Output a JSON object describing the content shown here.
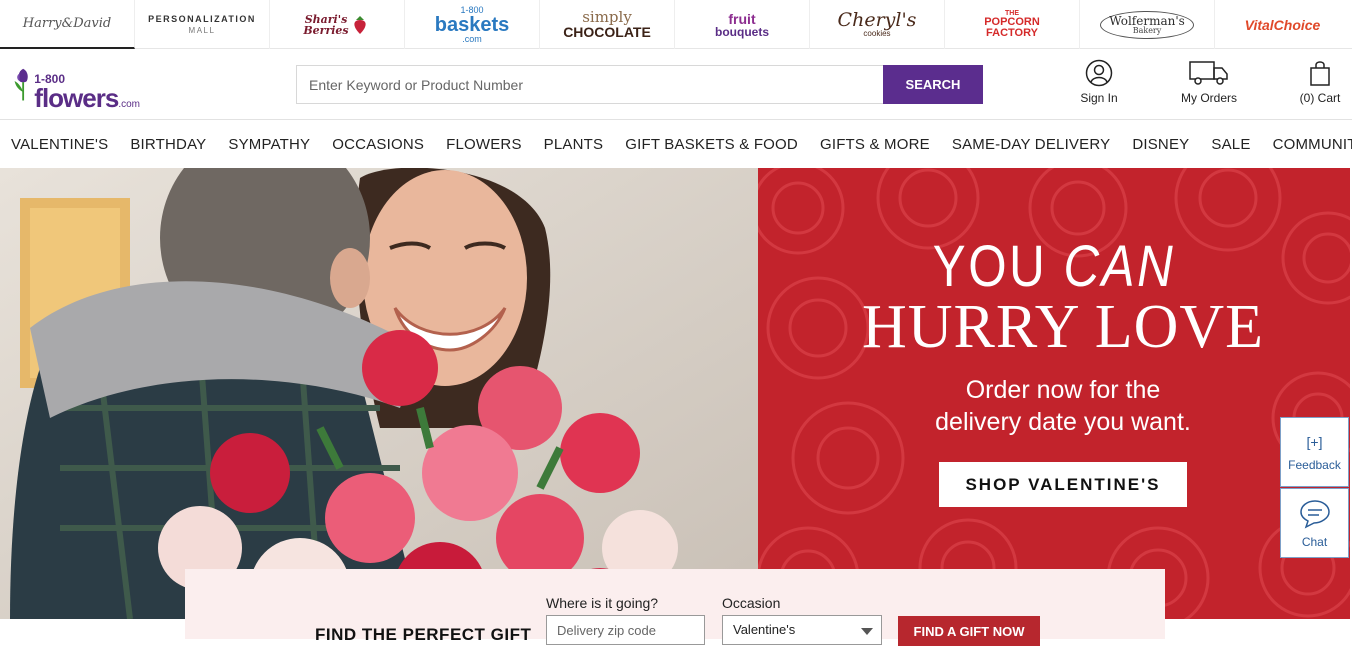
{
  "brand_bar": {
    "items": [
      {
        "label": "Harry&David"
      },
      {
        "label": "PERSONALIZATION",
        "sub": "MALL"
      },
      {
        "label": "Shari's",
        "sub": "Berries"
      },
      {
        "label": "1-800",
        "sub": "baskets",
        "sub2": ".com"
      },
      {
        "label": "simply",
        "sub": "CHOCOLATE"
      },
      {
        "label": "fruit",
        "sub": "bouquets"
      },
      {
        "label": "Cheryl's",
        "sub": "cookies"
      },
      {
        "label": "THE",
        "sub": "POPCORN",
        "sub2": "FACTORY"
      },
      {
        "label": "Wolferman's",
        "sub": "Bakery"
      },
      {
        "label": "VitalChoice"
      }
    ]
  },
  "header": {
    "logo": {
      "num": "1-800",
      "name": "flowers",
      "suffix": ".com"
    },
    "search": {
      "placeholder": "Enter Keyword or Product Number",
      "button": "SEARCH"
    },
    "sign_in": "Sign In",
    "my_orders": "My Orders",
    "cart": "(0) Cart"
  },
  "nav": {
    "items": [
      "VALENTINE'S",
      "BIRTHDAY",
      "SYMPATHY",
      "OCCASIONS",
      "FLOWERS",
      "PLANTS",
      "GIFT BASKETS & FOOD",
      "GIFTS & MORE",
      "SAME-DAY DELIVERY",
      "DISNEY",
      "SALE",
      "COMMUNITY"
    ]
  },
  "hero": {
    "title_a": "YOU",
    "title_b": "CAN",
    "title_line2": "HURRY LOVE",
    "subtitle_1": "Order now for the",
    "subtitle_2": "delivery date you want.",
    "cta": "SHOP VALENTINE'S"
  },
  "side_widgets": {
    "feedback_glyph": "[+]",
    "feedback": "Feedback",
    "chat": "Chat"
  },
  "gift_finder": {
    "title": "FIND THE PERFECT GIFT",
    "zip_label": "Where is it going?",
    "zip_placeholder": "Delivery zip code",
    "occasion_label": "Occasion",
    "occasion_value": "Valentine's",
    "button": "FIND A GIFT NOW"
  },
  "colors": {
    "brand_purple": "#5b2d8e",
    "hero_red": "#c8262e",
    "finder_button": "#b7272e",
    "finder_bg": "#fbeeee"
  }
}
